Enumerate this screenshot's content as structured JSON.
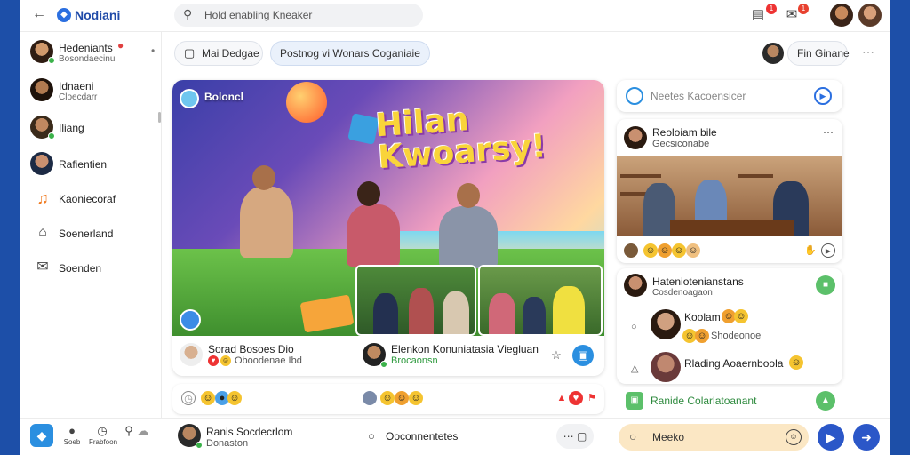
{
  "header": {
    "back_icon": "arrow-left-icon",
    "app_name": "Nodiani",
    "search_placeholder": "Hold enabling Kneaker",
    "icons": [
      "share-icon",
      "chat-icon"
    ],
    "badges": [
      "1",
      "1"
    ]
  },
  "sidebar": {
    "items": [
      {
        "label": "Hedeniants",
        "sub": "Bosondaecinu",
        "icon": "avatar",
        "online": true
      },
      {
        "label": "Idnaeni",
        "sub": "Cloecdarr",
        "icon": "avatar",
        "online": false
      },
      {
        "label": "Iliang",
        "sub": "",
        "icon": "avatar",
        "online": true
      },
      {
        "label": "Rafientien",
        "sub": "",
        "icon": "avatar",
        "online": false
      },
      {
        "label": "Kaoniecoraf",
        "sub": "",
        "icon": "music-icon",
        "online": false
      },
      {
        "label": "Soenerland",
        "sub": "",
        "icon": "bell-icon",
        "online": false
      },
      {
        "label": "Soenden",
        "sub": "",
        "icon": "mail-icon",
        "online": false
      }
    ]
  },
  "chips": {
    "chip1": "Mai Dedgae",
    "chip2": "Postnog vi Wonars Coganiaie",
    "profile_label": "Fin Ginane"
  },
  "post": {
    "badge_label": "Boloncl",
    "hero_title_line1": "Hilan",
    "hero_title_line2": "Kwoarsy!",
    "author1_name": "Sorad Bosoes Dio",
    "author1_sub": "Oboodenae Ibd",
    "author2_name": "Elenkon Konuniatasia Viegluan",
    "author2_sub": "Brocaonsn"
  },
  "right": {
    "input_placeholder": "Neetes Kacoensicer",
    "post_author": "Reoloiam bile",
    "post_sub": "Gecsiconabe",
    "comment_header": "Hateniotenianstans",
    "comment_header_sub": "Cosdenoagaon",
    "comment1_name": "Koolam",
    "comment1_sub": "Shodeonoe",
    "comment2_name": "Rlading Aoaernboola",
    "invite_label": "Ranide Colarlatoanant"
  },
  "bottom": {
    "tab1": "Soeb",
    "tab2": "Frabfoon",
    "user_name": "Ranis Socdecrlom",
    "user_sub": "Donaston",
    "comments_label": "Ooconnentetes",
    "compose_placeholder": "Meeko"
  }
}
